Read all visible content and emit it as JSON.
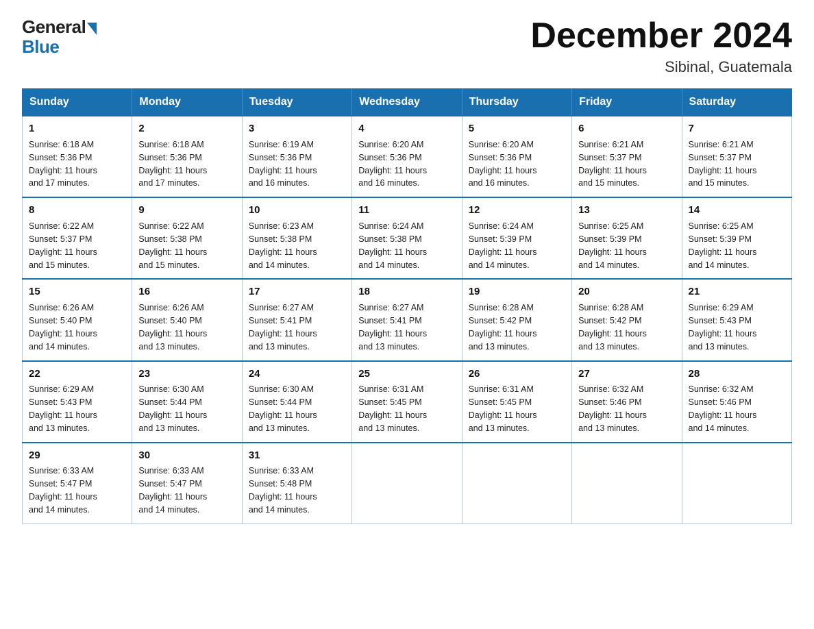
{
  "logo": {
    "general": "General",
    "blue": "Blue"
  },
  "title": "December 2024",
  "subtitle": "Sibinal, Guatemala",
  "days_of_week": [
    "Sunday",
    "Monday",
    "Tuesday",
    "Wednesday",
    "Thursday",
    "Friday",
    "Saturday"
  ],
  "weeks": [
    [
      {
        "day": "1",
        "sunrise": "6:18 AM",
        "sunset": "5:36 PM",
        "daylight": "11 hours and 17 minutes."
      },
      {
        "day": "2",
        "sunrise": "6:18 AM",
        "sunset": "5:36 PM",
        "daylight": "11 hours and 17 minutes."
      },
      {
        "day": "3",
        "sunrise": "6:19 AM",
        "sunset": "5:36 PM",
        "daylight": "11 hours and 16 minutes."
      },
      {
        "day": "4",
        "sunrise": "6:20 AM",
        "sunset": "5:36 PM",
        "daylight": "11 hours and 16 minutes."
      },
      {
        "day": "5",
        "sunrise": "6:20 AM",
        "sunset": "5:36 PM",
        "daylight": "11 hours and 16 minutes."
      },
      {
        "day": "6",
        "sunrise": "6:21 AM",
        "sunset": "5:37 PM",
        "daylight": "11 hours and 15 minutes."
      },
      {
        "day": "7",
        "sunrise": "6:21 AM",
        "sunset": "5:37 PM",
        "daylight": "11 hours and 15 minutes."
      }
    ],
    [
      {
        "day": "8",
        "sunrise": "6:22 AM",
        "sunset": "5:37 PM",
        "daylight": "11 hours and 15 minutes."
      },
      {
        "day": "9",
        "sunrise": "6:22 AM",
        "sunset": "5:38 PM",
        "daylight": "11 hours and 15 minutes."
      },
      {
        "day": "10",
        "sunrise": "6:23 AM",
        "sunset": "5:38 PM",
        "daylight": "11 hours and 14 minutes."
      },
      {
        "day": "11",
        "sunrise": "6:24 AM",
        "sunset": "5:38 PM",
        "daylight": "11 hours and 14 minutes."
      },
      {
        "day": "12",
        "sunrise": "6:24 AM",
        "sunset": "5:39 PM",
        "daylight": "11 hours and 14 minutes."
      },
      {
        "day": "13",
        "sunrise": "6:25 AM",
        "sunset": "5:39 PM",
        "daylight": "11 hours and 14 minutes."
      },
      {
        "day": "14",
        "sunrise": "6:25 AM",
        "sunset": "5:39 PM",
        "daylight": "11 hours and 14 minutes."
      }
    ],
    [
      {
        "day": "15",
        "sunrise": "6:26 AM",
        "sunset": "5:40 PM",
        "daylight": "11 hours and 14 minutes."
      },
      {
        "day": "16",
        "sunrise": "6:26 AM",
        "sunset": "5:40 PM",
        "daylight": "11 hours and 13 minutes."
      },
      {
        "day": "17",
        "sunrise": "6:27 AM",
        "sunset": "5:41 PM",
        "daylight": "11 hours and 13 minutes."
      },
      {
        "day": "18",
        "sunrise": "6:27 AM",
        "sunset": "5:41 PM",
        "daylight": "11 hours and 13 minutes."
      },
      {
        "day": "19",
        "sunrise": "6:28 AM",
        "sunset": "5:42 PM",
        "daylight": "11 hours and 13 minutes."
      },
      {
        "day": "20",
        "sunrise": "6:28 AM",
        "sunset": "5:42 PM",
        "daylight": "11 hours and 13 minutes."
      },
      {
        "day": "21",
        "sunrise": "6:29 AM",
        "sunset": "5:43 PM",
        "daylight": "11 hours and 13 minutes."
      }
    ],
    [
      {
        "day": "22",
        "sunrise": "6:29 AM",
        "sunset": "5:43 PM",
        "daylight": "11 hours and 13 minutes."
      },
      {
        "day": "23",
        "sunrise": "6:30 AM",
        "sunset": "5:44 PM",
        "daylight": "11 hours and 13 minutes."
      },
      {
        "day": "24",
        "sunrise": "6:30 AM",
        "sunset": "5:44 PM",
        "daylight": "11 hours and 13 minutes."
      },
      {
        "day": "25",
        "sunrise": "6:31 AM",
        "sunset": "5:45 PM",
        "daylight": "11 hours and 13 minutes."
      },
      {
        "day": "26",
        "sunrise": "6:31 AM",
        "sunset": "5:45 PM",
        "daylight": "11 hours and 13 minutes."
      },
      {
        "day": "27",
        "sunrise": "6:32 AM",
        "sunset": "5:46 PM",
        "daylight": "11 hours and 13 minutes."
      },
      {
        "day": "28",
        "sunrise": "6:32 AM",
        "sunset": "5:46 PM",
        "daylight": "11 hours and 14 minutes."
      }
    ],
    [
      {
        "day": "29",
        "sunrise": "6:33 AM",
        "sunset": "5:47 PM",
        "daylight": "11 hours and 14 minutes."
      },
      {
        "day": "30",
        "sunrise": "6:33 AM",
        "sunset": "5:47 PM",
        "daylight": "11 hours and 14 minutes."
      },
      {
        "day": "31",
        "sunrise": "6:33 AM",
        "sunset": "5:48 PM",
        "daylight": "11 hours and 14 minutes."
      },
      null,
      null,
      null,
      null
    ]
  ],
  "labels": {
    "sunrise": "Sunrise:",
    "sunset": "Sunset:",
    "daylight": "Daylight:"
  }
}
